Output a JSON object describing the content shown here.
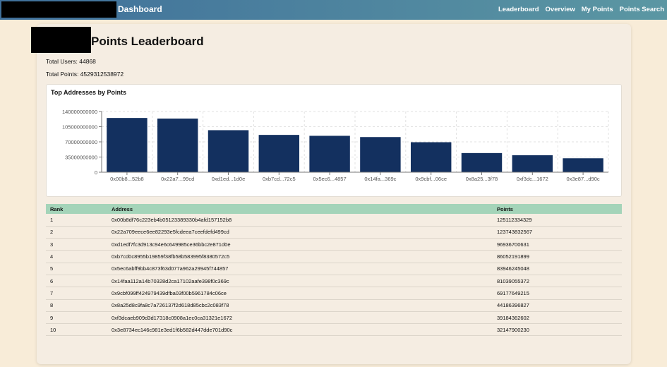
{
  "nav": {
    "brand": "Dashboard",
    "links": [
      "Leaderboard",
      "Overview",
      "My Points",
      "Points Search"
    ]
  },
  "page": {
    "title": "Points Leaderboard",
    "total_users": "Total Users: 44868",
    "total_points": "Total Points: 4529312538972"
  },
  "chart_title": "Top Addresses by Points",
  "colors": {
    "bar": "#13305f",
    "table_header": "#a4d4b9",
    "nav_start": "#3f6f9a",
    "nav_end": "#5b97a3"
  },
  "chart_data": {
    "type": "bar",
    "title": "Top Addresses by Points",
    "categories": [
      "0x00b8...52b8",
      "0x22a7...99cd",
      "0xd1ed...1d0e",
      "0xb7cd...72c5",
      "0x5ec6...4857",
      "0x14fa...369c",
      "0x9cbf...06ce",
      "0x8a25...3f78",
      "0xf3dc...1672",
      "0x3e87...d90c"
    ],
    "values": [
      125112334329,
      123743832567,
      96936700631,
      86052191899,
      83946245048,
      81039055372,
      69177649215,
      44186396827,
      39184362602,
      32147900230
    ],
    "ylim": [
      0,
      140000000000
    ],
    "yticks": [
      "0",
      "35000000000",
      "70000000000",
      "105000000000",
      "140000000000"
    ],
    "ytick_values": [
      0,
      35000000000,
      70000000000,
      105000000000,
      140000000000
    ],
    "grid": true
  },
  "table": {
    "headers": [
      "Rank",
      "Address",
      "Points"
    ],
    "rows": [
      [
        "1",
        "0x00b8df76c223eb4b05123389330b4afd157152b8",
        "125112334329"
      ],
      [
        "2",
        "0x22a709eece6ee82293e5fcdeea7ceefdefd499cd",
        "123743832567"
      ],
      [
        "3",
        "0xd1edf7fc3d913c94e6c649985ce36bbc2e871d0e",
        "96936700631"
      ],
      [
        "4",
        "0xb7cd0c8955b19859f38fb58b583995f8380572c5",
        "86052191899"
      ],
      [
        "5",
        "0x5ec6abff9bb4c873f63d077a962a29945f744857",
        "83946245048"
      ],
      [
        "6",
        "0x14faa112a14b70328d2ca17102aafe398f0c369c",
        "81039055372"
      ],
      [
        "7",
        "0x9cbf099ff424979439dfba03f00b5961784c06ce",
        "69177649215"
      ],
      [
        "8",
        "0x8a25d8c9fa8c7a726137f2d618d85cbc2c083f78",
        "44186396827"
      ],
      [
        "9",
        "0xf3dcaeb909d3d17318c0908a1ec0ca31321e1672",
        "39184362602"
      ],
      [
        "10",
        "0x3e8734ec146c981e3ed1f6b582d447dde701d90c",
        "32147900230"
      ]
    ]
  }
}
